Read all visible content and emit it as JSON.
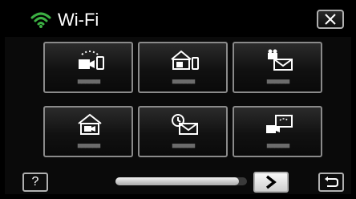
{
  "header": {
    "title": "Wi-Fi",
    "wifi_icon": "wifi-signal-icon",
    "accent_color": "#3cb043",
    "close_icon": "close-icon"
  },
  "tiles": [
    {
      "icon": "camera-to-smartphone-icon",
      "label": "■■■■■■"
    },
    {
      "icon": "home-camera-smartphone-icon",
      "label": "■■■■■■"
    },
    {
      "icon": "video-mail-icon",
      "label": "■■■■■■"
    },
    {
      "icon": "home-camera-icon",
      "label": "■■■■■■"
    },
    {
      "icon": "timer-mail-icon",
      "label": "■■■■■■"
    },
    {
      "icon": "camera-to-tv-icon",
      "label": "■■■■■■"
    }
  ],
  "footer": {
    "help_label": "?",
    "scroll_position": 0.94,
    "next_icon": "chevron-right-icon",
    "back_icon": "return-icon"
  }
}
